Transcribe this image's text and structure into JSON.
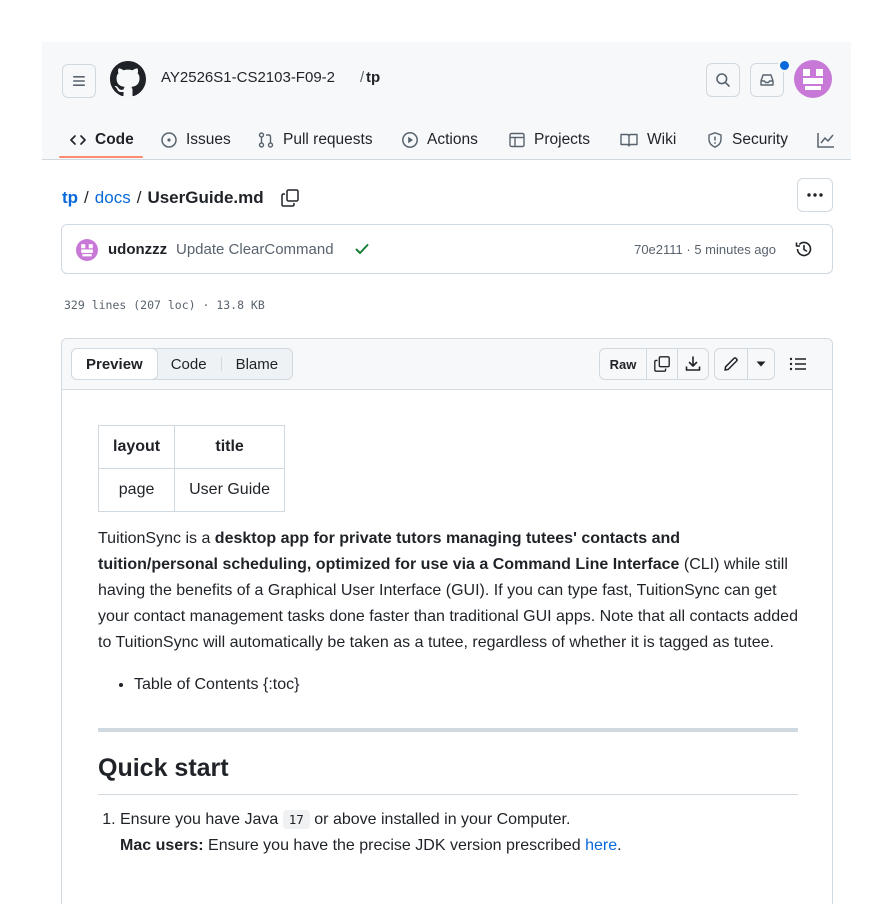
{
  "header": {
    "owner": "AY2526S1-CS2103-F09-2",
    "separator": "/",
    "repo": "tp"
  },
  "tabs": [
    {
      "label": "Code",
      "icon": "code-icon",
      "active": true
    },
    {
      "label": "Issues",
      "icon": "issue-icon"
    },
    {
      "label": "Pull requests",
      "icon": "pull-request-icon"
    },
    {
      "label": "Actions",
      "icon": "play-icon"
    },
    {
      "label": "Projects",
      "icon": "table-icon"
    },
    {
      "label": "Wiki",
      "icon": "book-icon"
    },
    {
      "label": "Security",
      "icon": "shield-icon"
    }
  ],
  "path": {
    "repo": "tp",
    "sep": "/",
    "folder": "docs",
    "file": "UserGuide.md"
  },
  "commit": {
    "author": "udonzzz",
    "message": "Update ClearCommand",
    "meta": "70e2111 · 5 minutes ago"
  },
  "stats": "329 lines (207 loc) · 13.8 KB",
  "file_toolbar": {
    "views": [
      "Preview",
      "Code",
      "Blame"
    ],
    "active_view": "Preview",
    "raw_label": "Raw"
  },
  "doc": {
    "table": {
      "headers": [
        "layout",
        "title"
      ],
      "row": [
        "page",
        "User Guide"
      ]
    },
    "intro_pre": "TuitionSync is a ",
    "intro_bold": "desktop app for private tutors managing tutees' contacts and tuition/personal scheduling, optimized for use via a Command Line Interface",
    "intro_post": " (CLI) while still having the benefits of a Graphical User Interface (GUI). If you can type fast, TuitionSync can get your contact management tasks done faster than traditional GUI apps. Note that all contacts added to TuitionSync will automatically be taken as a tutee, regardless of whether it is tagged as tutee.",
    "toc_item": "Table of Contents {:toc}",
    "heading": "Quick start",
    "step1_pre": "Ensure you have Java ",
    "step1_code": "17",
    "step1_post": " or above installed in your Computer.",
    "step1_mac_bold": "Mac users:",
    "step1_mac_text": " Ensure you have the precise JDK version prescribed ",
    "step1_mac_link": "here",
    "step1_mac_end": "."
  },
  "colors": {
    "accent": "#0969da",
    "tab_underline": "#fd8c73",
    "success": "#1a7f37",
    "notification": "#0969da",
    "avatar": "#c879d8"
  }
}
